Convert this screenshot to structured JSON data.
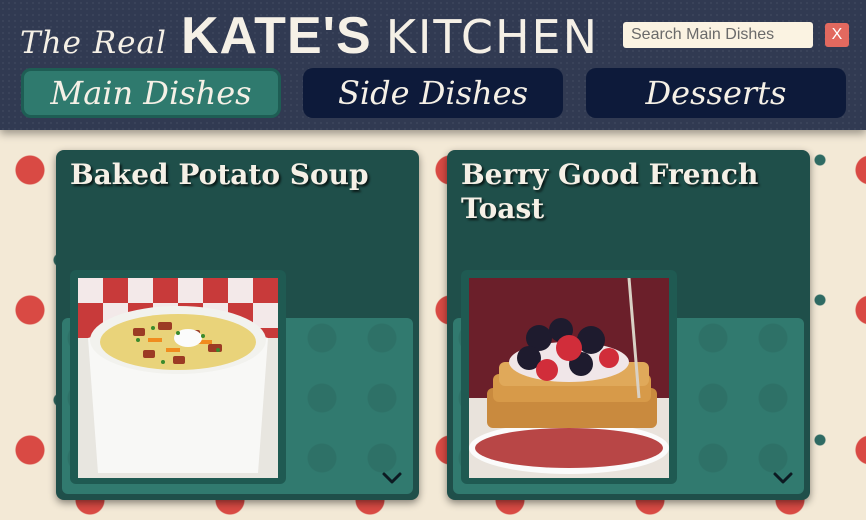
{
  "header": {
    "brand": {
      "the_real": "The Real",
      "kates": "KATE'S",
      "kitchen": "KITCHEN"
    },
    "search": {
      "placeholder": "Search Main Dishes",
      "value": ""
    },
    "close_label": "X",
    "tabs": [
      {
        "label": "Main Dishes",
        "active": true
      },
      {
        "label": "Side Dishes",
        "active": false
      },
      {
        "label": "Desserts",
        "active": false
      }
    ]
  },
  "recipes": [
    {
      "title": "Baked Potato Soup",
      "image_icon": "soup-photo",
      "expand_icon": "chevron-down-icon"
    },
    {
      "title": "Berry Good French Toast",
      "image_icon": "french-toast-photo",
      "expand_icon": "chevron-down-icon"
    }
  ],
  "colors": {
    "header_bg": "#313a52",
    "tab_active": "#2f7a6e",
    "tab_idle": "#0d1a3a",
    "card_bg": "#1f4f4a",
    "card_panel": "#317a6f",
    "close_button": "#e2695f",
    "cherry": "#d94a44"
  }
}
